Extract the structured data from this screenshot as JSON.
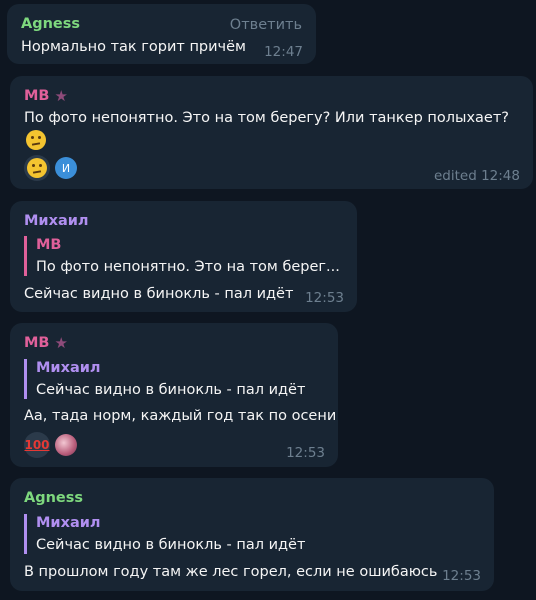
{
  "colors": {
    "background": "#0e1621",
    "bubble": "#182533",
    "agness": "#7ed87e",
    "mb": "#e0609a",
    "mikhail": "#b08ff0",
    "meta": "#6d7f8f"
  },
  "messages": [
    {
      "sender": "Agness",
      "action": "Ответить",
      "text": "Нормально так горит причём",
      "time": "12:47"
    },
    {
      "sender": "MB",
      "badge_icon": "star-icon",
      "text": "По фото непонятно. Это на том берегу? Или танкер полыхает?",
      "reactions": [
        {
          "icon": "thinking-face-emoji"
        },
        {
          "icon": "avatar",
          "letter": "И"
        }
      ],
      "time": "edited 12:48"
    },
    {
      "sender": "Михаил",
      "quote": {
        "name": "MB",
        "text": "По фото непонятно. Это на том берег..."
      },
      "text": "Сейчас видно в бинокль - пал идёт",
      "time": "12:53"
    },
    {
      "sender": "MB",
      "badge_icon": "star-icon",
      "quote": {
        "name": "Михаил",
        "text": "Сейчас видно в бинокль - пал идёт"
      },
      "text": "Аа, тада норм, каждый год так по осени",
      "reactions": [
        {
          "icon": "hundred-points-emoji",
          "label": "100"
        },
        {
          "icon": "avatar"
        }
      ],
      "time": "12:53"
    },
    {
      "sender": "Agness",
      "quote": {
        "name": "Михаил",
        "text": "Сейчас видно в бинокль - пал идёт"
      },
      "text": "В прошлом году там же лес горел, если не ошибаюсь",
      "time": "12:53"
    }
  ]
}
